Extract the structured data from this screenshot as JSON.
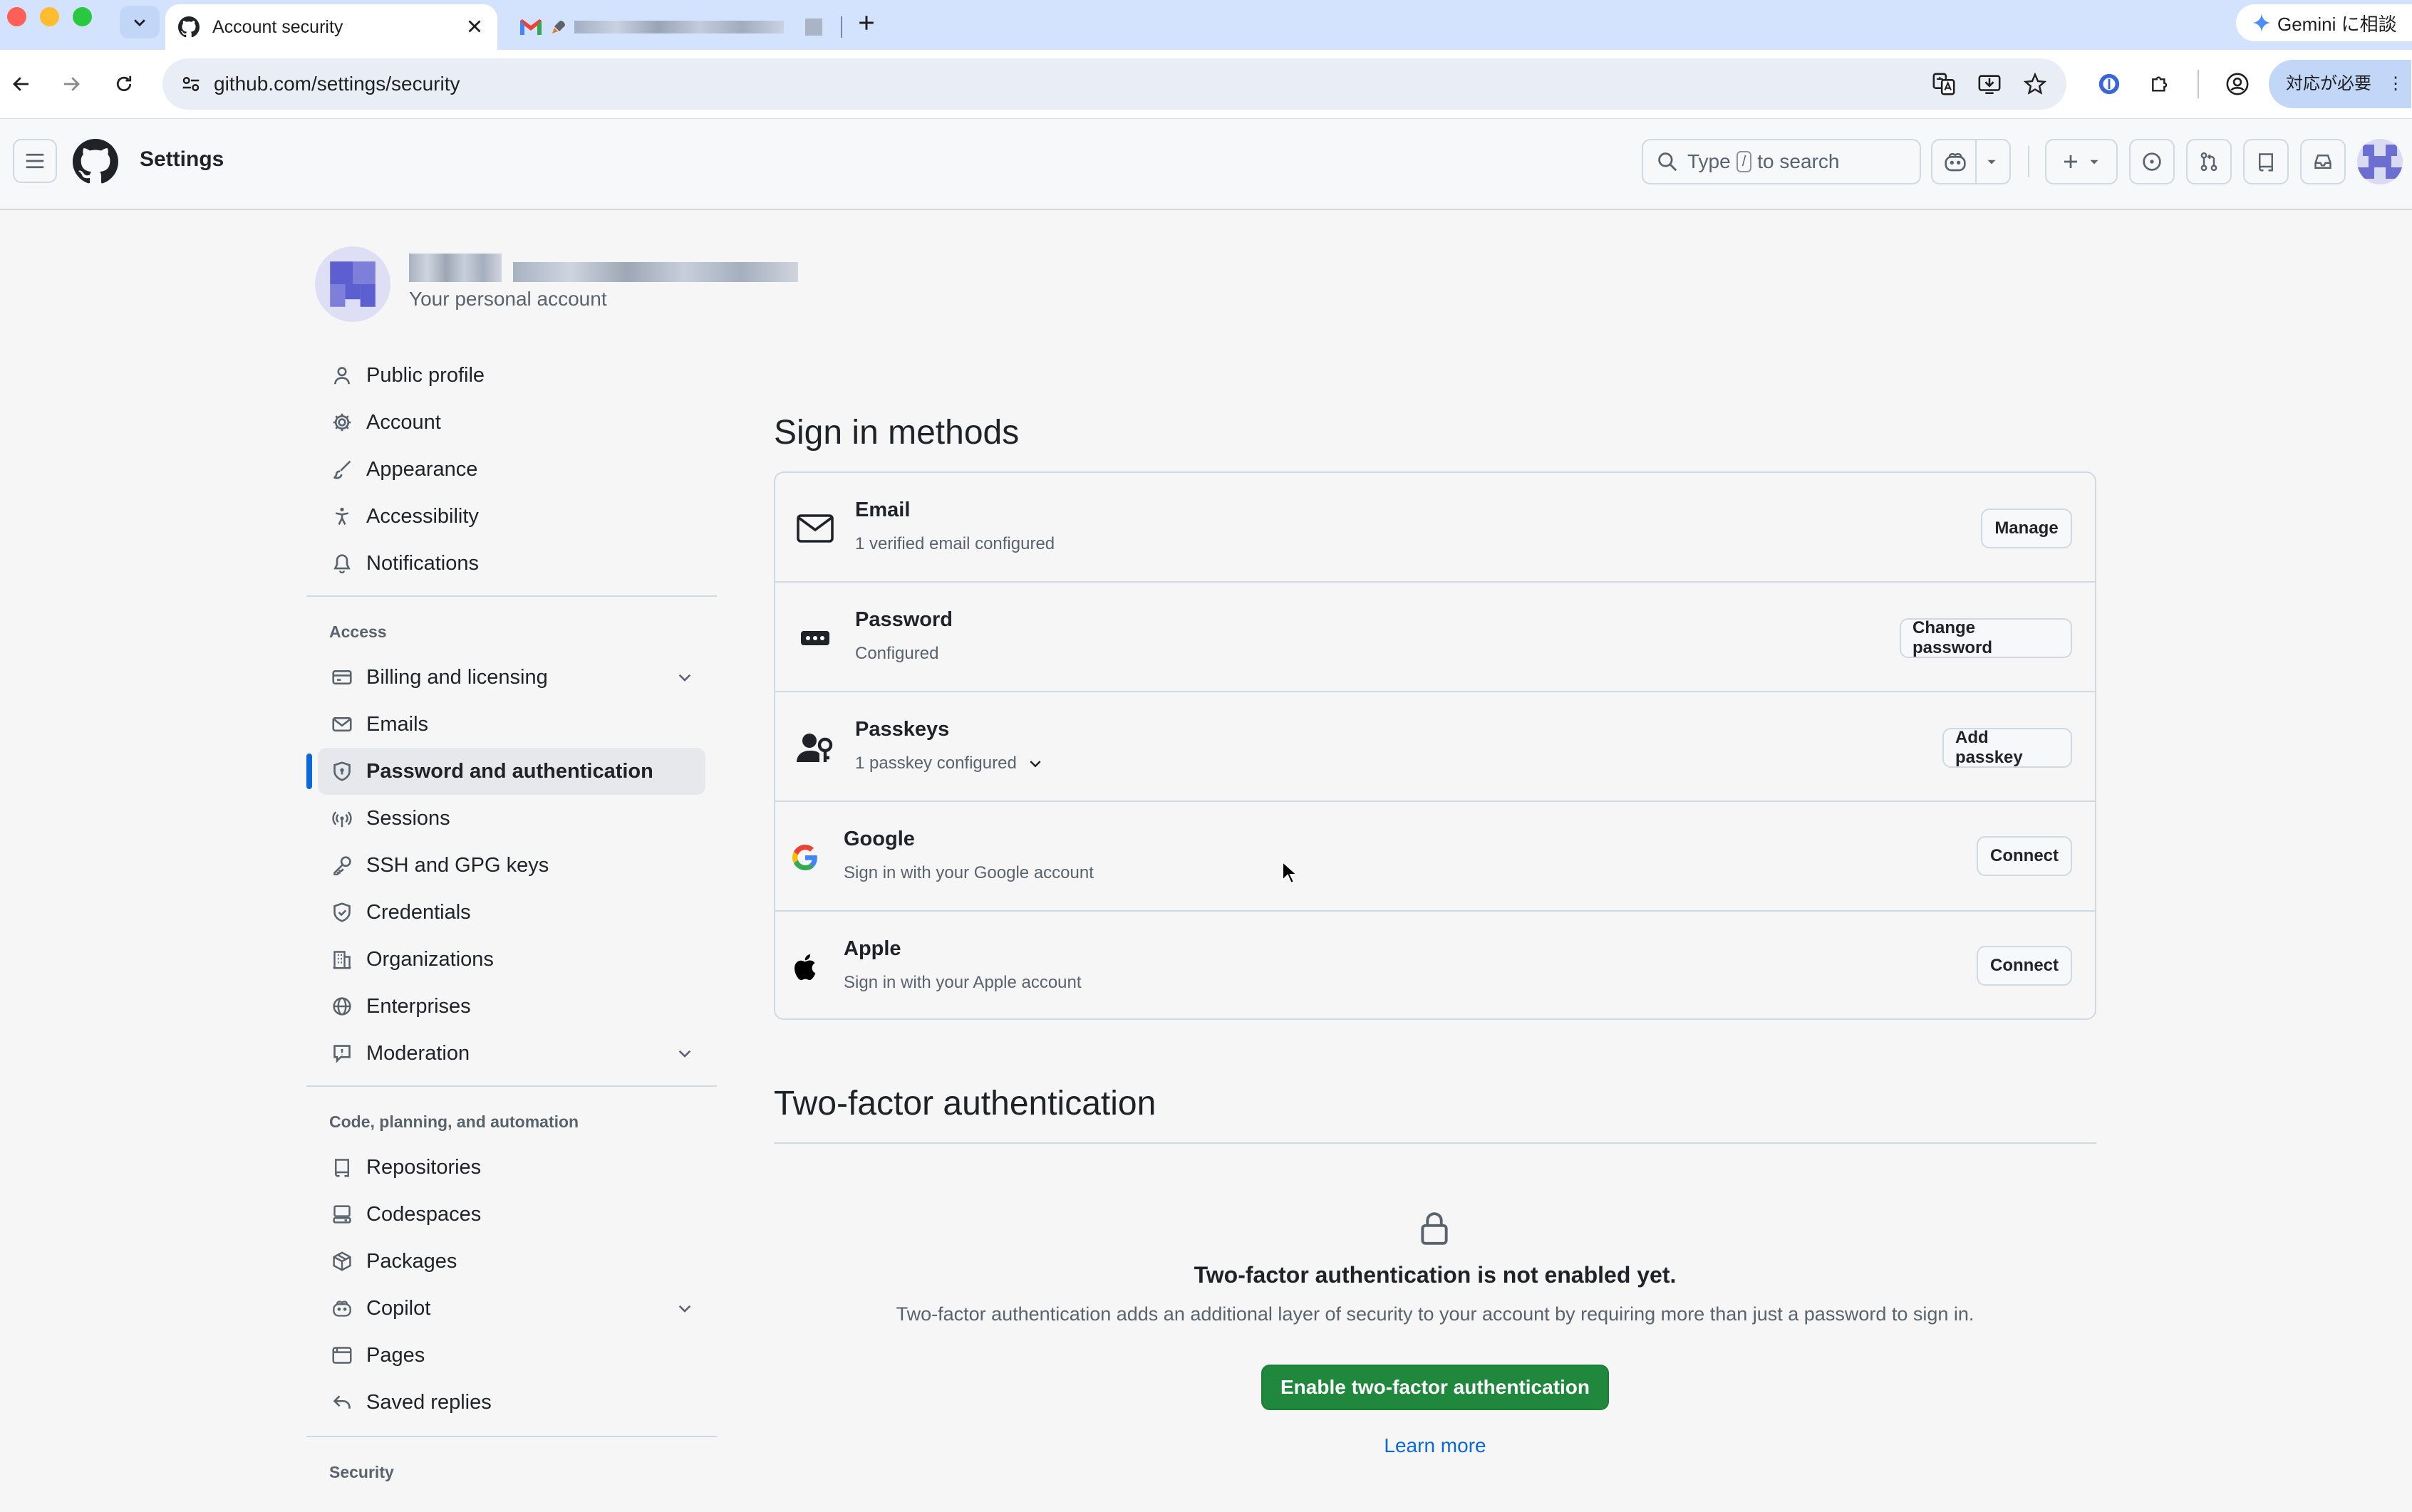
{
  "browser": {
    "active_tab_title": "Account security",
    "url": "github.com/settings/security",
    "gemini_label": "Gemini に相談",
    "alert_label": "対応が必要",
    "icons": [
      "chevron-down-icon",
      "github-icon",
      "close-icon",
      "gmail-icon",
      "rocket-icon",
      "plus-icon",
      "back-icon",
      "forward-icon",
      "reload-icon",
      "site-info-icon",
      "translate-icon",
      "install-icon",
      "star-icon",
      "extension-icon",
      "puzzle-icon",
      "profile-icon",
      "more-icon"
    ]
  },
  "header": {
    "title": "Settings",
    "search_prefix": "Type",
    "search_key": "/",
    "search_suffix": "to search"
  },
  "sidebar": {
    "account_caption": "Your personal account",
    "top_items": [
      {
        "label": "Public profile",
        "icon": "person-icon"
      },
      {
        "label": "Account",
        "icon": "gear-icon"
      },
      {
        "label": "Appearance",
        "icon": "paintbrush-icon"
      },
      {
        "label": "Accessibility",
        "icon": "accessibility-icon"
      },
      {
        "label": "Notifications",
        "icon": "bell-icon"
      }
    ],
    "access_heading": "Access",
    "access_items": [
      {
        "label": "Billing and licensing",
        "icon": "credit-card-icon",
        "expandable": true
      },
      {
        "label": "Emails",
        "icon": "mail-icon"
      },
      {
        "label": "Password and authentication",
        "icon": "shield-lock-icon",
        "selected": true
      },
      {
        "label": "Sessions",
        "icon": "broadcast-icon"
      },
      {
        "label": "SSH and GPG keys",
        "icon": "key-icon"
      },
      {
        "label": "Credentials",
        "icon": "shield-check-icon"
      },
      {
        "label": "Organizations",
        "icon": "organization-icon"
      },
      {
        "label": "Enterprises",
        "icon": "globe-icon"
      },
      {
        "label": "Moderation",
        "icon": "report-icon",
        "expandable": true
      }
    ],
    "code_heading": "Code, planning, and automation",
    "code_items": [
      {
        "label": "Repositories",
        "icon": "repo-icon"
      },
      {
        "label": "Codespaces",
        "icon": "codespaces-icon"
      },
      {
        "label": "Packages",
        "icon": "package-icon"
      },
      {
        "label": "Copilot",
        "icon": "copilot-icon",
        "expandable": true
      },
      {
        "label": "Pages",
        "icon": "browser-icon"
      },
      {
        "label": "Saved replies",
        "icon": "reply-icon"
      }
    ],
    "security_heading": "Security"
  },
  "sign_in": {
    "title": "Sign in methods",
    "methods": [
      {
        "title": "Email",
        "subtitle": "1 verified email configured",
        "button": "Manage",
        "icon": "mail-icon"
      },
      {
        "title": "Password",
        "subtitle": "Configured",
        "button": "Change password",
        "icon": "password-icon"
      },
      {
        "title": "Passkeys",
        "subtitle": "1 passkey configured",
        "button": "Add passkey",
        "icon": "passkey-icon"
      },
      {
        "title": "Google",
        "subtitle": "Sign in with your Google account",
        "button": "Connect",
        "icon": "google-icon"
      },
      {
        "title": "Apple",
        "subtitle": "Sign in with your Apple account",
        "button": "Connect",
        "icon": "apple-icon"
      }
    ]
  },
  "two_factor": {
    "title": "Two-factor authentication",
    "heading": "Two-factor authentication is not enabled yet.",
    "description": "Two-factor authentication adds an additional layer of security to your account by requiring more than just a password to sign in.",
    "button": "Enable two-factor authentication",
    "learn_more": "Learn more"
  },
  "colors": {
    "primary_button": "#1f883d",
    "link": "#0969da",
    "selected_indicator": "#0969da"
  }
}
